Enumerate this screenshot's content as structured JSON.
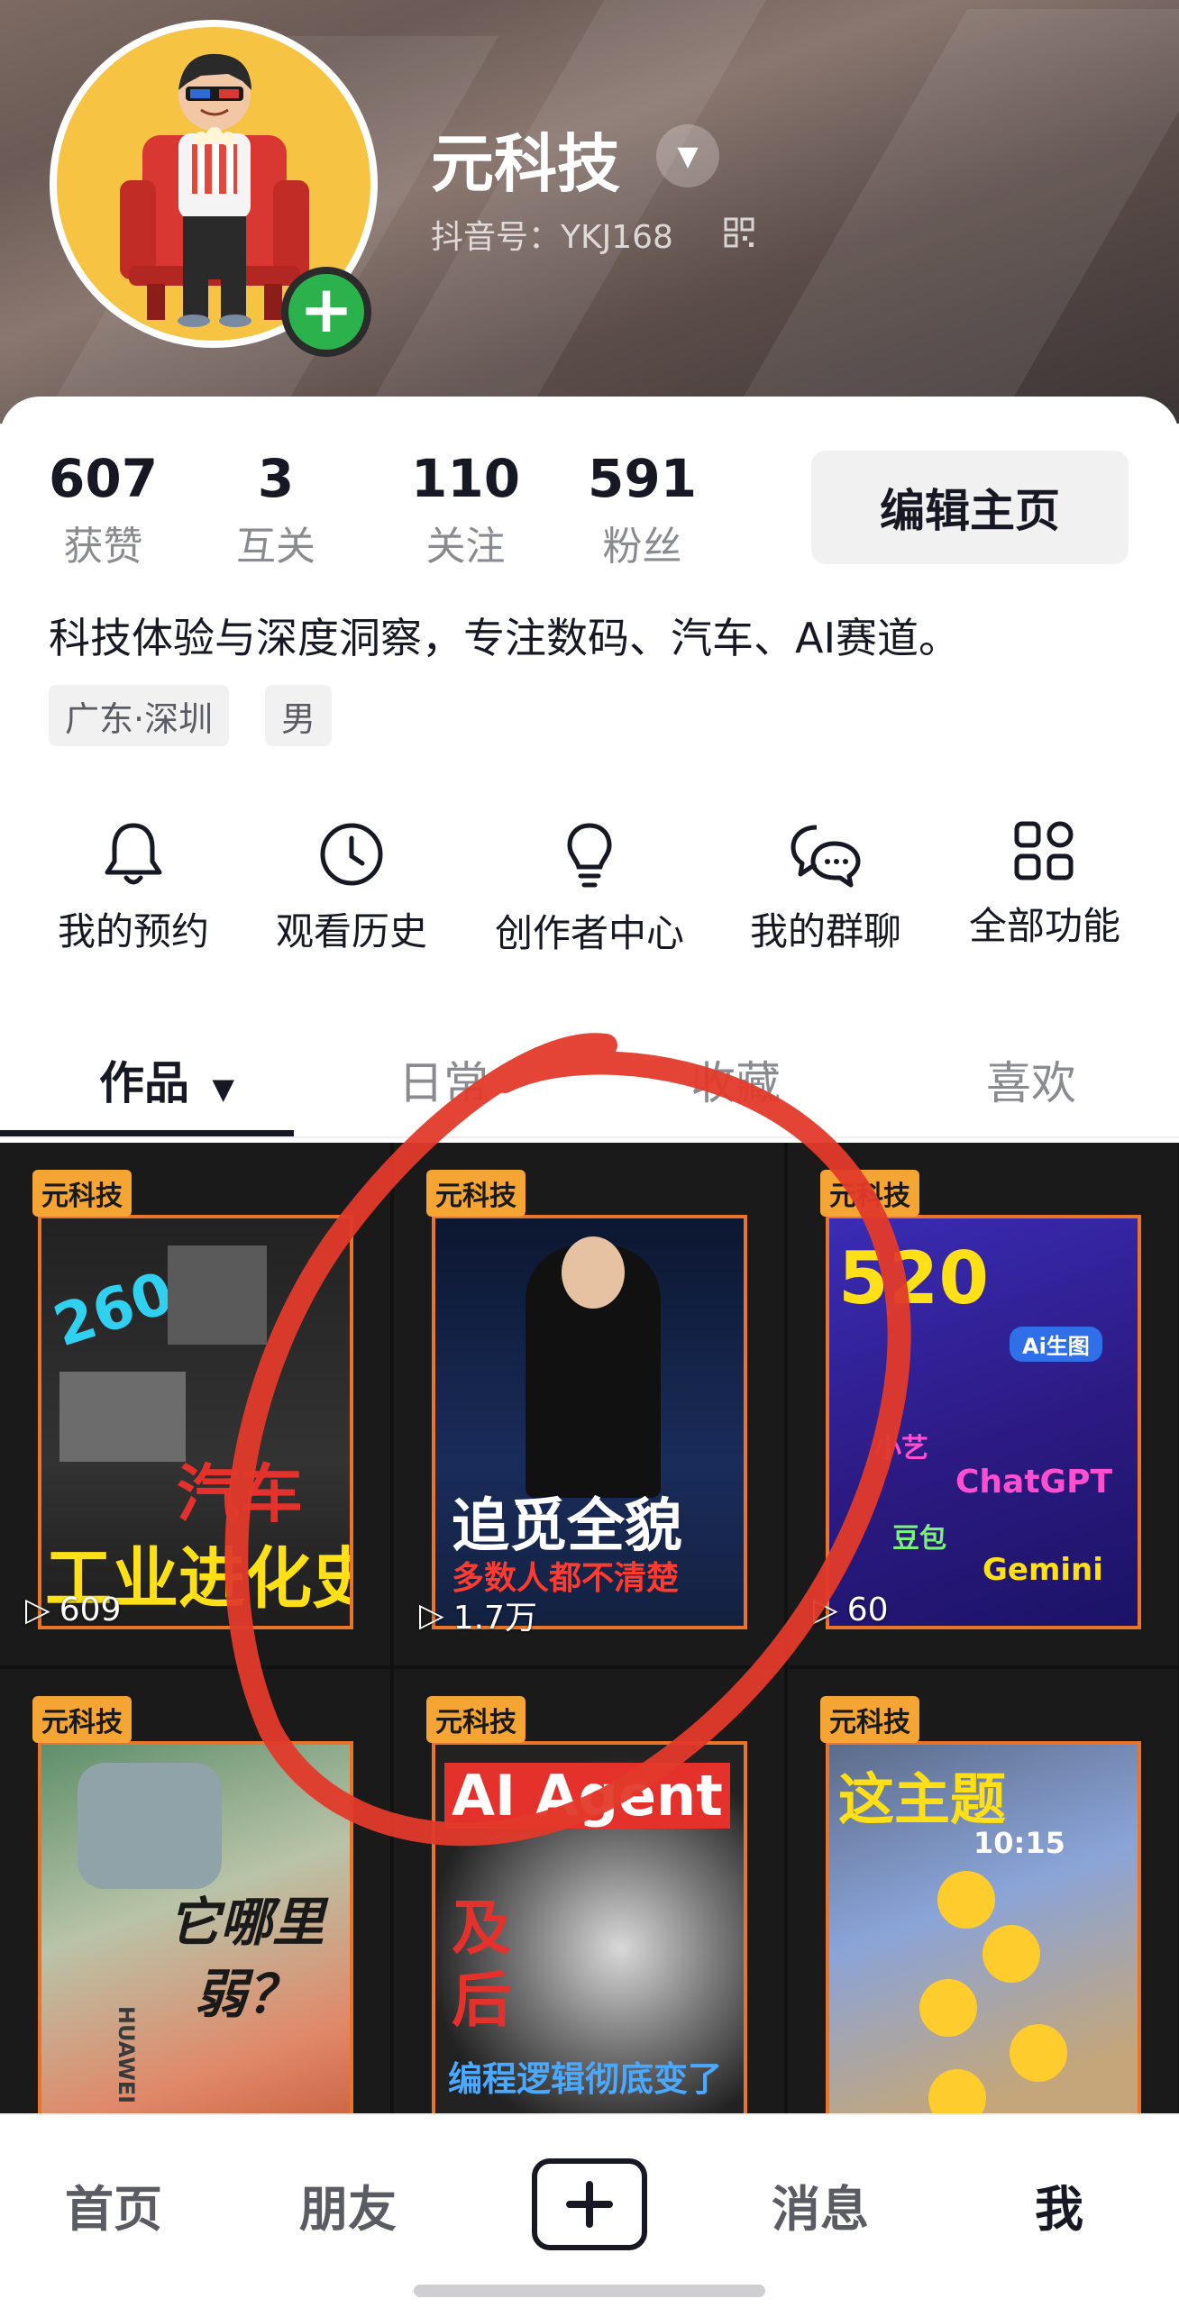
{
  "profile": {
    "name": "元科技",
    "douyin_id": "抖音号：YKJ168",
    "bio": "科技体验与深度洞察，专注数码、汽车、AI赛道。",
    "tags": [
      "广东·深圳",
      "男"
    ],
    "edit_label": "编辑主页"
  },
  "stats": [
    {
      "value": "607",
      "label": "获赞"
    },
    {
      "value": "3",
      "label": "互关"
    },
    {
      "value": "110",
      "label": "关注"
    },
    {
      "value": "591",
      "label": "粉丝"
    }
  ],
  "quick_actions": [
    {
      "label": "我的预约",
      "icon": "bell-icon"
    },
    {
      "label": "观看历史",
      "icon": "clock-icon"
    },
    {
      "label": "创作者中心",
      "icon": "lightbulb-icon"
    },
    {
      "label": "我的群聊",
      "icon": "chat-bubbles-icon"
    },
    {
      "label": "全部功能",
      "icon": "grid-icon"
    }
  ],
  "tabs": [
    {
      "label": "作品",
      "active": true
    },
    {
      "label": "日常"
    },
    {
      "label": "收藏"
    },
    {
      "label": "喜欢"
    }
  ],
  "videos": [
    {
      "brand": "元科技",
      "plays": "609",
      "text1": "260年",
      "text2": "汽车",
      "text3": "工业进化史"
    },
    {
      "brand": "元科技",
      "plays": "1.7万",
      "text1": "追觅全貌",
      "text2": "多数人都不清楚"
    },
    {
      "brand": "元科技",
      "plays": "60",
      "text1": "520",
      "text2": "Ai生图",
      "text3": "ChatGPT",
      "text4": "豆包",
      "text5": "Gemini",
      "text6": "小艺"
    },
    {
      "brand": "元科技",
      "text1": "它哪里",
      "text2": "弱？",
      "text3": "HUAWEI"
    },
    {
      "brand": "元科技",
      "text1": "AI Agent",
      "text2": "及",
      "text3": "后",
      "text4": "编程逻辑彻底变了"
    },
    {
      "brand": "元科技",
      "text1": "这主题",
      "text2": "10:15"
    }
  ],
  "bottom_nav": [
    "首页",
    "朋友",
    "消息",
    "我"
  ],
  "colors": {
    "accent_green": "#2bb24c",
    "brand_orange": "#f5a533",
    "annotation_red": "#e23a2a"
  }
}
